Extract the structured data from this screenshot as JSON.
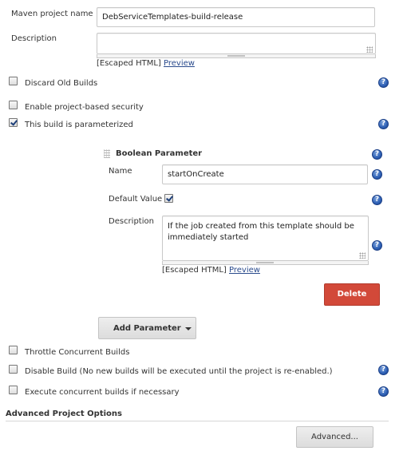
{
  "project": {
    "name_label": "Maven project name",
    "name_value": "DebServiceTemplates-build-release",
    "description_label": "Description",
    "description_value": "",
    "escaped_html": "[Escaped HTML]",
    "preview": "Preview"
  },
  "options": [
    {
      "label": "Discard Old Builds",
      "checked": false
    },
    {
      "label": "Enable project-based security",
      "checked": false
    },
    {
      "label": "This build is parameterized",
      "checked": true
    }
  ],
  "parameter": {
    "title": "Boolean Parameter",
    "name_label": "Name",
    "name_value": "startOnCreate",
    "default_label": "Default Value",
    "default_checked": true,
    "description_label": "Description",
    "description_value": "If the job created from this template should be immediately started",
    "escaped_html": "[Escaped HTML]",
    "preview": "Preview",
    "delete_label": "Delete"
  },
  "add_parameter_label": "Add Parameter",
  "more_options": [
    {
      "label": "Throttle Concurrent Builds",
      "checked": false
    },
    {
      "label": "Disable Build (No new builds will be executed until the project is re-enabled.)",
      "checked": false
    },
    {
      "label": "Execute concurrent builds if necessary",
      "checked": false
    }
  ],
  "advanced": {
    "section_title": "Advanced Project Options",
    "button_label": "Advanced..."
  },
  "help_glyph": "?",
  "colors": {
    "delete": "#d24939",
    "link": "#2a4b8d",
    "help": "#2d5fb4"
  },
  "icons": [
    "help-icon",
    "checkbox-checked-icon",
    "checkbox-unchecked-icon",
    "drag-handle-icon",
    "caret-down-icon",
    "resize-grip-icon"
  ]
}
